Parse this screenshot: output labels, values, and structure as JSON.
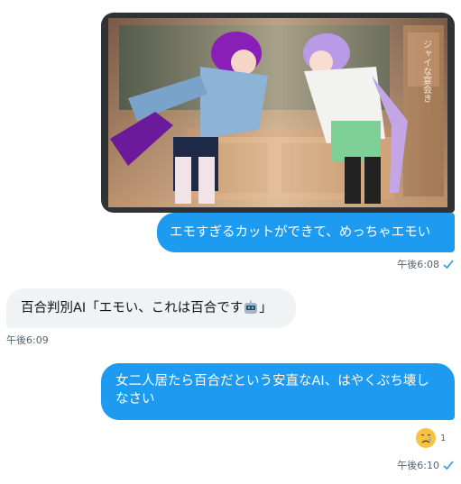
{
  "messages": [
    {
      "type": "image",
      "direction": "outgoing",
      "image_text": "ジャイな宴会き"
    },
    {
      "type": "text",
      "direction": "outgoing",
      "text": "エモすぎるカットができて、めっちゃエモい",
      "time": "午後6:08"
    },
    {
      "type": "text",
      "direction": "incoming",
      "text": "百合判別AI「エモい、これは百合です",
      "text_after_emoji": "」",
      "emoji": "robot-face-icon",
      "time": "午後6:09"
    },
    {
      "type": "text",
      "direction": "outgoing",
      "text_line1": "女二人居たら百合だという安直なAI、はやくぶち壊し",
      "text_line2": "なさい",
      "time": "午後6:10",
      "reaction": {
        "emoji": "crying-face-icon",
        "count": "1"
      }
    }
  ],
  "colors": {
    "outgoing_bubble": "#1d9bf0",
    "incoming_bubble": "#eff3f4",
    "meta_text": "#536471",
    "check": "#1d9bf0"
  }
}
